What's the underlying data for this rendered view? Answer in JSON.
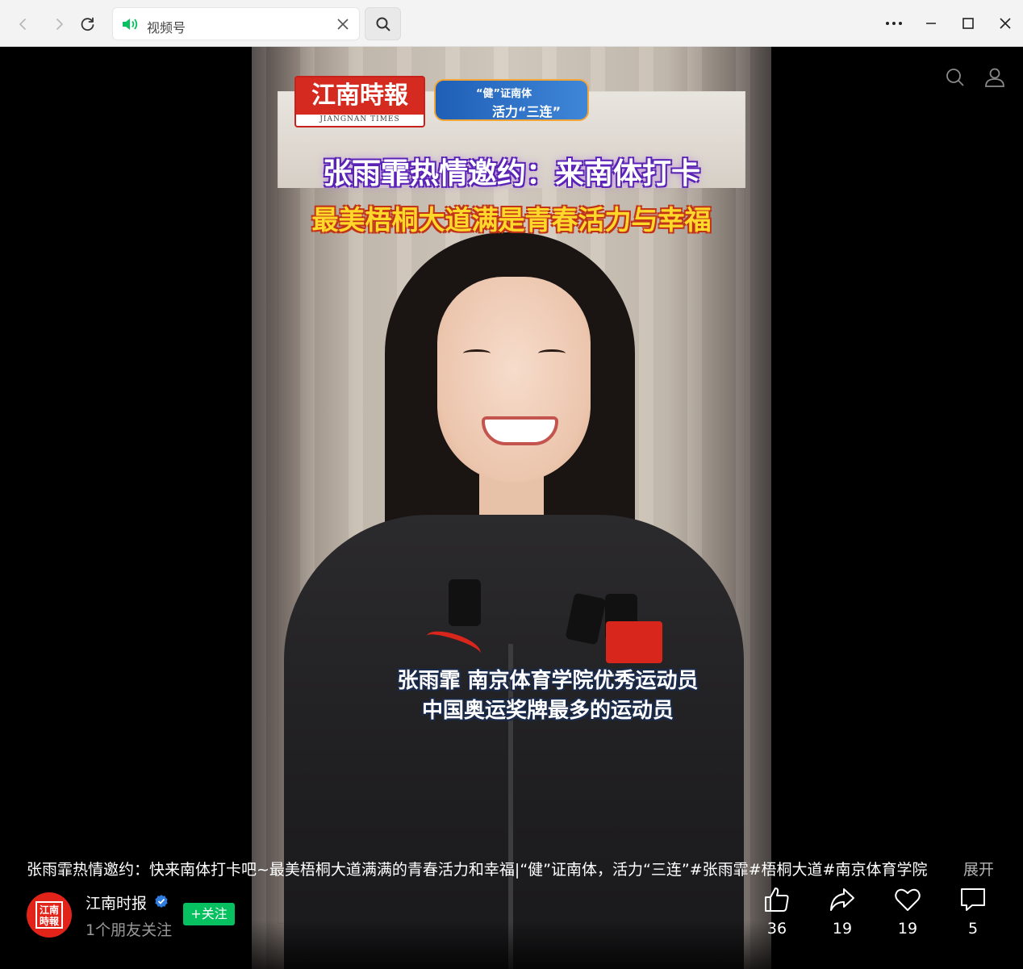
{
  "addressbar": {
    "text": "视频号"
  },
  "video": {
    "brand_logo": "江南時報",
    "brand_logo_sub": "JIANGNAN TIMES",
    "campaign_line1": "“健”证南体",
    "campaign_line2": "活力“三连”",
    "headline1": "张雨霏热情邀约：来南体打卡",
    "headline2": "最美梧桐大道满是青春活力与幸福",
    "caption1": "张雨霏 南京体育学院优秀运动员",
    "caption2": "中国奥运奖牌最多的运动员"
  },
  "post": {
    "description": "张雨霏热情邀约：快来南体打卡吧~最美梧桐大道满满的青春活力和幸福|“健”证南体，活力“三连”#张雨霏#梧桐大道#南京体育学院",
    "expand_label": "展开",
    "account_name": "江南时报",
    "avatar_text": "江南時報",
    "friends_text": "1个朋友关注",
    "follow_label": "+关注"
  },
  "actions": {
    "like_count": "36",
    "share_count": "19",
    "favorite_count": "19",
    "comment_count": "5"
  },
  "colors": {
    "follow_green": "#07c160",
    "speaker_green": "#07c160",
    "verified_blue": "#2f7de1"
  }
}
